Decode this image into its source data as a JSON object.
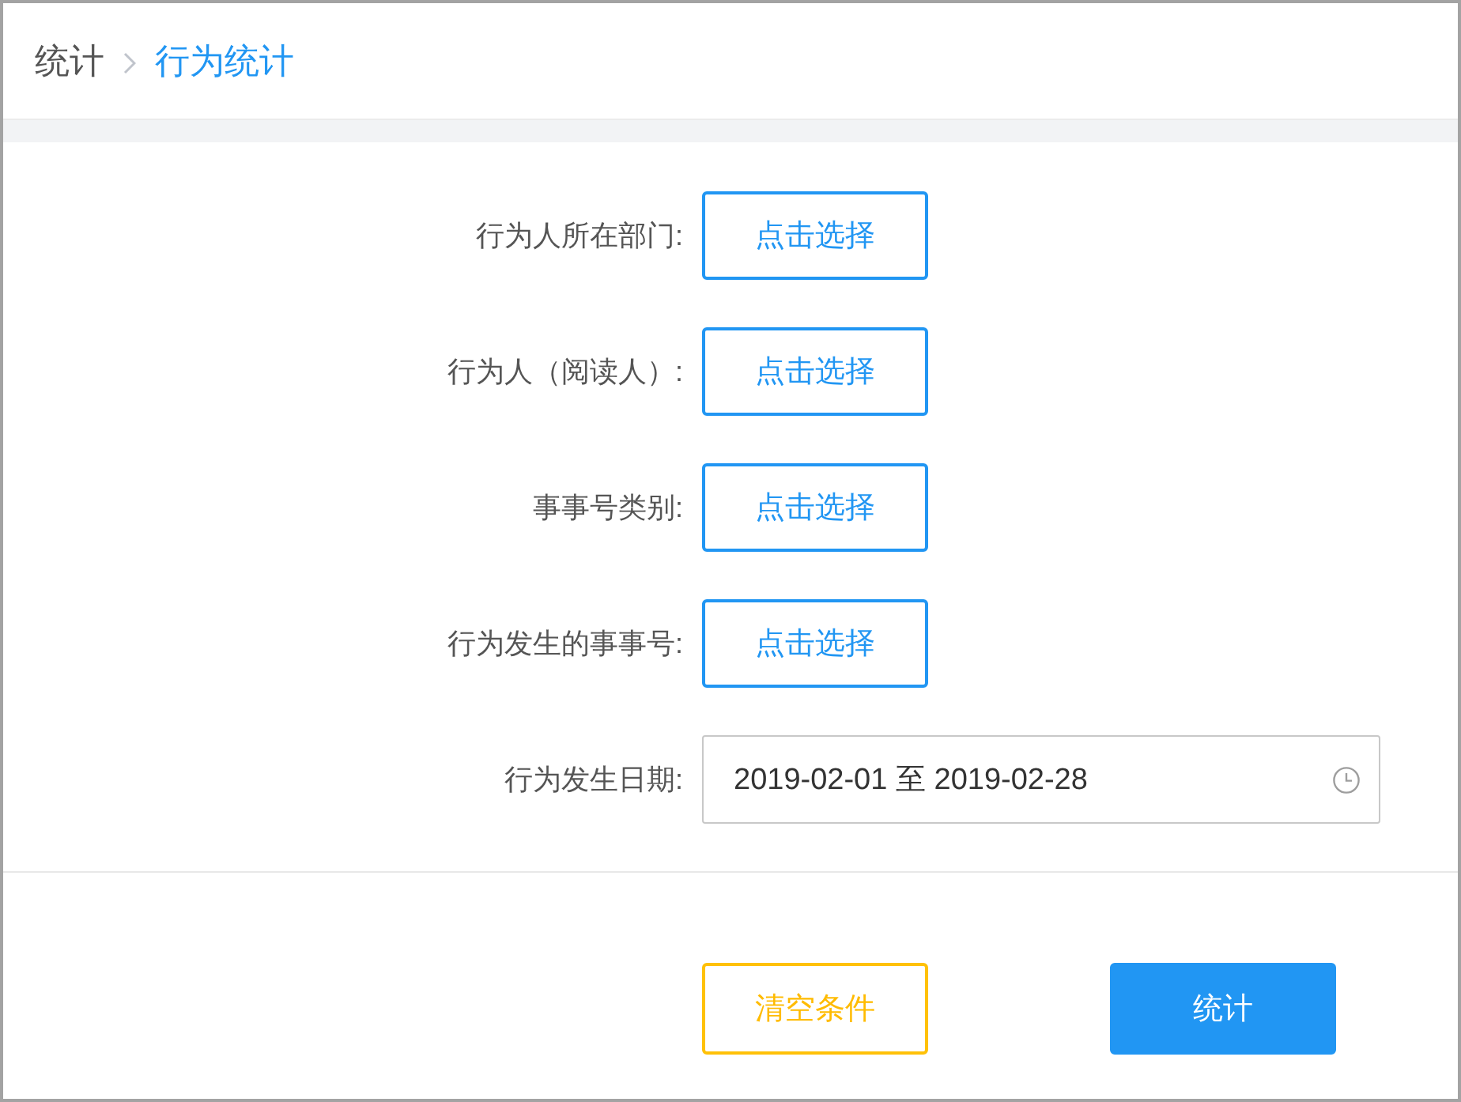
{
  "breadcrumb": [
    {
      "label": "统计",
      "current": false
    },
    {
      "label": "行为统计",
      "current": true
    }
  ],
  "form": {
    "fields": [
      {
        "kind": "picker",
        "label": "行为人所在部门:",
        "button": "点击选择"
      },
      {
        "kind": "picker",
        "label": "行为人（阅读人）:",
        "button": "点击选择"
      },
      {
        "kind": "picker",
        "label": "事事号类别:",
        "button": "点击选择"
      },
      {
        "kind": "picker",
        "label": "行为发生的事事号:",
        "button": "点击选择"
      },
      {
        "kind": "date_range",
        "label": "行为发生日期:",
        "value": "2019-02-01 至 2019-02-28"
      }
    ]
  },
  "actions": [
    {
      "kind": "outline",
      "label": "清空条件"
    },
    {
      "kind": "primary",
      "label": "统计"
    }
  ]
}
